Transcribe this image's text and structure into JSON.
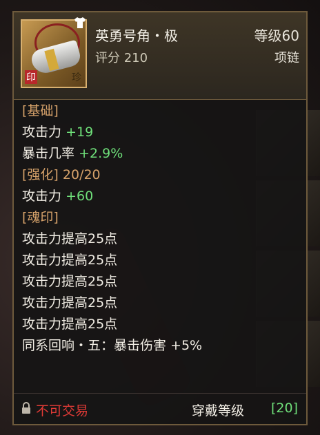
{
  "item": {
    "name": "英勇号角・极",
    "level": "等级60",
    "score": "评分 210",
    "slot": "项链",
    "badge_seal": "印",
    "badge_rare": "珍",
    "icon": "horn-necklace-icon",
    "equip_icon": "shirt-icon"
  },
  "lines": [
    {
      "kind": "section",
      "text": "[基础]"
    },
    {
      "kind": "stat",
      "label": "攻击力",
      "value": "+19"
    },
    {
      "kind": "stat",
      "label": "暴击几率",
      "value": "+2.9%"
    },
    {
      "kind": "section",
      "text": "[强化] 20/20"
    },
    {
      "kind": "stat",
      "label": "攻击力",
      "value": "+60"
    },
    {
      "kind": "section",
      "text": "[魂印]"
    },
    {
      "kind": "plain",
      "text": "攻击力提高25点"
    },
    {
      "kind": "plain",
      "text": "攻击力提高25点"
    },
    {
      "kind": "plain",
      "text": "攻击力提高25点"
    },
    {
      "kind": "plain",
      "text": "攻击力提高25点"
    },
    {
      "kind": "plain",
      "text": "攻击力提高25点"
    },
    {
      "kind": "plain",
      "text": "同系回响・五：暴击伤害 +5%"
    }
  ],
  "footer": {
    "trade_status": "不可交易",
    "wear_label": "穿戴等级",
    "wear_value": "[20]"
  },
  "colors": {
    "section": "#d6a26a",
    "bonus": "#6fe07a",
    "untradable": "#e03a36",
    "border": "#6e5a3c"
  }
}
